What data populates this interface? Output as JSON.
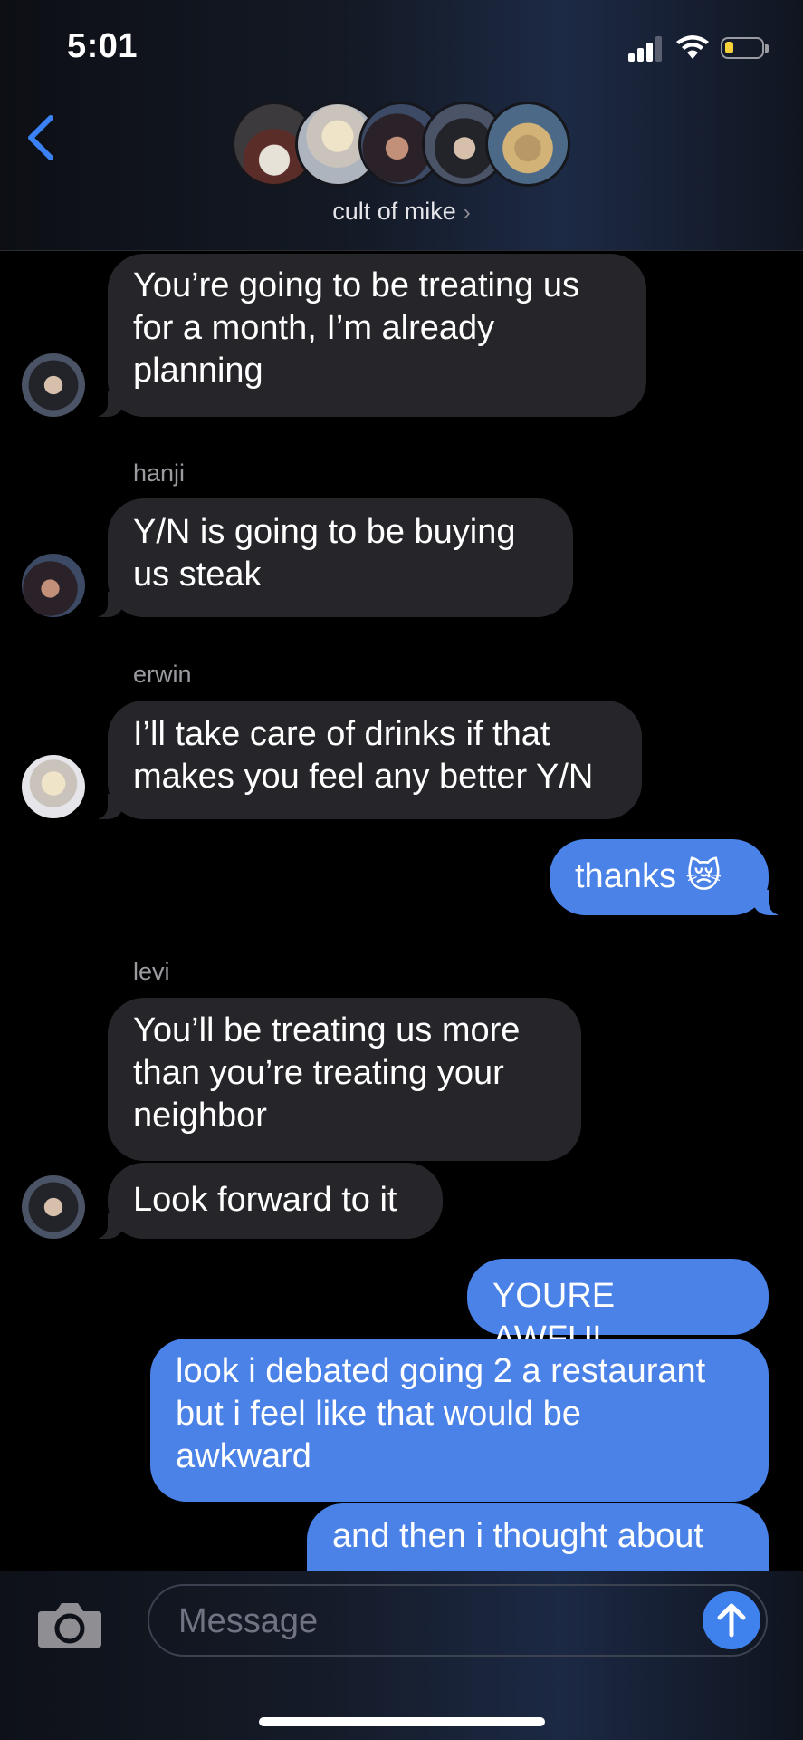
{
  "status_bar": {
    "time": "5:01",
    "signal_bars": 4,
    "signal_active": 3,
    "battery_level": 0.2
  },
  "header": {
    "group_name": "cult of mike",
    "chevron": "›",
    "back_icon": "chevron-left-icon",
    "member_avatar_count": 5
  },
  "messages": [
    {
      "from": "in",
      "lines": [
        "You’re going to be treating us",
        "for a month, I’m already",
        "planning"
      ]
    },
    {
      "sender": "hanji",
      "from": "in",
      "lines": [
        "Y/N is going to be buying",
        "us steak"
      ]
    },
    {
      "sender": "erwin",
      "from": "in",
      "lines": [
        "I’ll take care of drinks if that",
        "makes you feel any better Y/N"
      ]
    },
    {
      "from": "out",
      "lines": [
        "thanks 😿"
      ]
    },
    {
      "sender": "levi",
      "from": "in",
      "lines": [
        "You’ll be treating us more",
        "than you’re treating your",
        "neighbor"
      ]
    },
    {
      "from": "in",
      "lines": [
        "Look forward to it"
      ]
    },
    {
      "from": "out",
      "lines": [
        "YOURE AWFUL"
      ]
    },
    {
      "from": "out",
      "lines": [
        "look i debated going 2 a restaurant",
        "but i feel like that would be",
        "awkward"
      ]
    },
    {
      "from": "out",
      "lines": [
        "and then i thought about"
      ]
    }
  ],
  "input_bar": {
    "placeholder": "Message",
    "camera_icon": "camera-icon",
    "send_icon": "arrow-up-icon"
  },
  "colors": {
    "incoming_bubble": "#26262a",
    "outgoing_bubble": "#4a82e8",
    "accent": "#3f82ee",
    "battery": "#f7d23a"
  }
}
